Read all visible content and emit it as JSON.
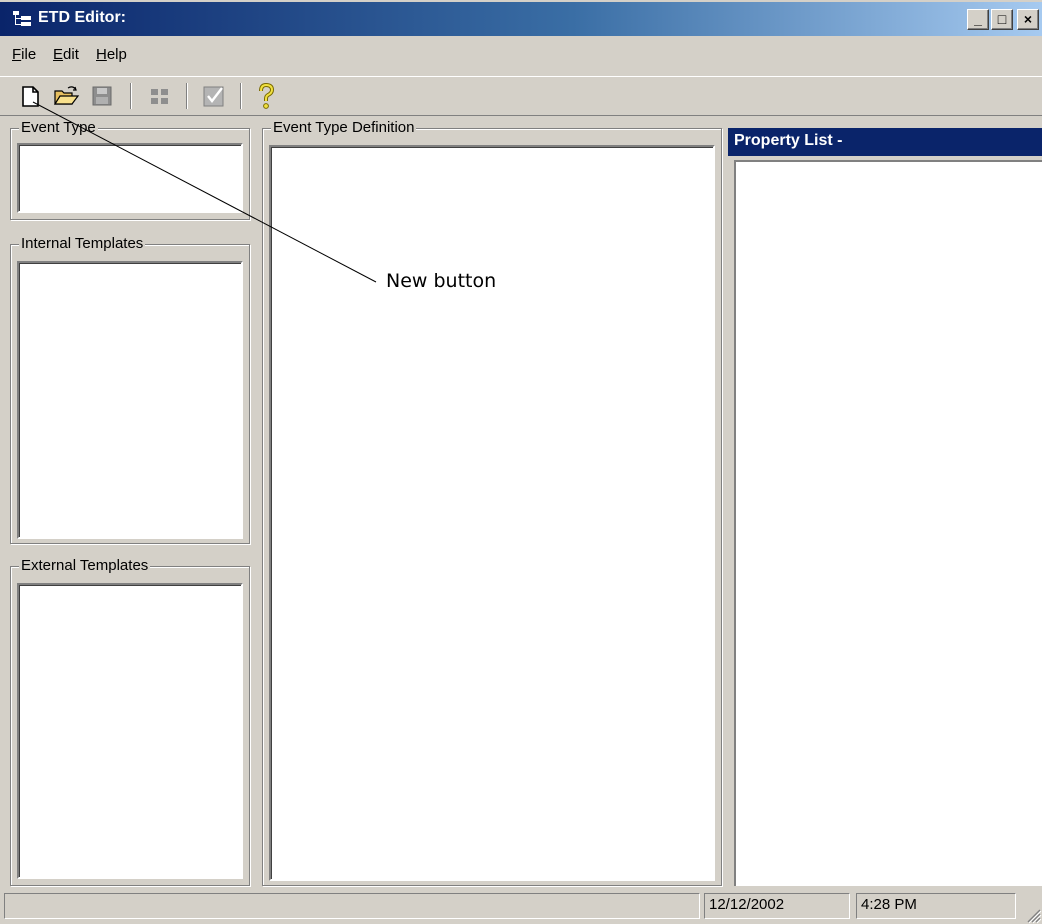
{
  "window": {
    "title": "ETD Editor:",
    "controls": {
      "minimize": "_",
      "maximize": "□",
      "close": "×"
    }
  },
  "menu": {
    "items": [
      {
        "label": "File",
        "accel": "F",
        "rest": "ile"
      },
      {
        "label": "Edit",
        "accel": "E",
        "rest": "dit"
      },
      {
        "label": "Help",
        "accel": "H",
        "rest": "elp"
      }
    ]
  },
  "toolbar": {
    "icons": [
      "new-document-icon",
      "open-folder-icon",
      "save-disk-icon",
      "grid-icon",
      "checkbox-icon",
      "help-question-icon"
    ]
  },
  "panels": {
    "event_type": {
      "label": "Event Type"
    },
    "internal_templates": {
      "label": "Internal Templates"
    },
    "external_templates": {
      "label": "External Templates"
    },
    "event_type_definition": {
      "label": "Event Type Definition"
    },
    "property_list": {
      "title": "Property List -"
    }
  },
  "statusbar": {
    "message": "",
    "date": "12/12/2002",
    "time": "4:28 PM"
  },
  "callout": {
    "label": "New button"
  },
  "colors": {
    "face": "#d4d0c8",
    "title_active": "#0a246a",
    "title_gradient_end": "#a6caf0",
    "window_bg": "#ffffff"
  }
}
